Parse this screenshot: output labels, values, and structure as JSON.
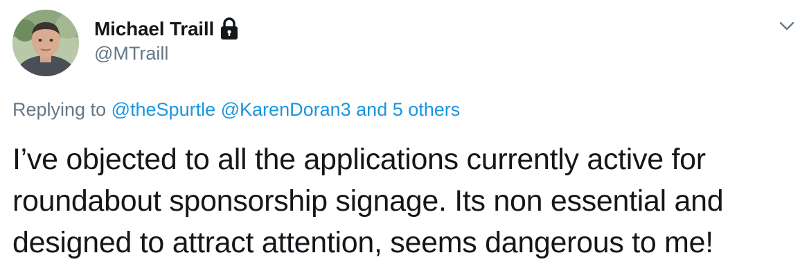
{
  "author": {
    "display_name": "Michael Traill",
    "handle": "@MTraill",
    "protected": true
  },
  "reply": {
    "prefix": "Replying to",
    "mention_1": "@theSpurtle",
    "mention_2": "@KarenDoran3",
    "others": "and 5 others"
  },
  "tweet": {
    "text": "I’ve objected to all the applications currently active for roundabout sponsorship signage. Its non essential and designed to attract attention, seems dangerous to me!"
  },
  "icons": {
    "lock": "lock-icon",
    "caret": "chevron-down-icon"
  },
  "colors": {
    "text_primary": "#14171a",
    "text_secondary": "#657786",
    "link": "#1b95e0"
  }
}
